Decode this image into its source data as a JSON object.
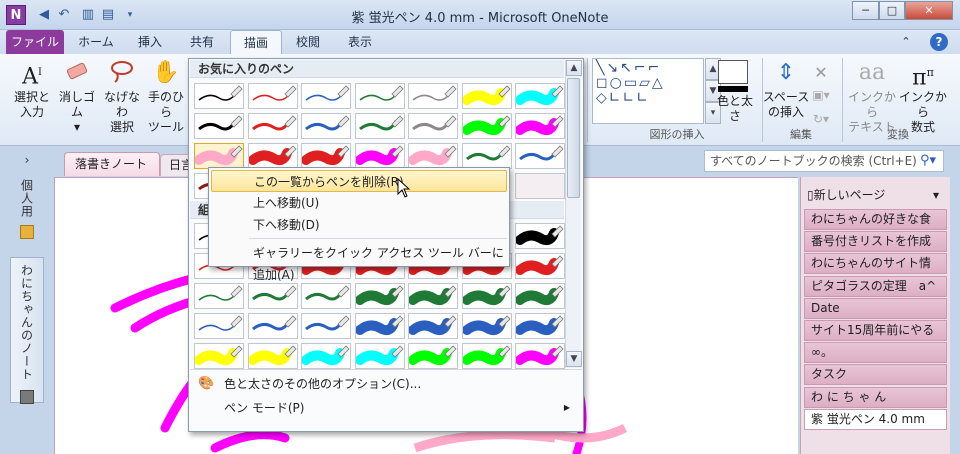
{
  "window": {
    "title": "紫 蛍光ペン 4.0 mm - Microsoft OneNote",
    "app_icon": "N",
    "buttons": {
      "minimize": "─",
      "maximize": "□",
      "close": "✕"
    }
  },
  "quick_access": [
    "back-icon",
    "undo-icon",
    "dock-icon",
    "page-icon",
    "customize-icon"
  ],
  "tabs": [
    {
      "label": "ファイル"
    },
    {
      "label": "ホーム"
    },
    {
      "label": "挿入"
    },
    {
      "label": "共有"
    },
    {
      "label": "描画"
    },
    {
      "label": "校閲"
    },
    {
      "label": "表示"
    }
  ],
  "ribbon": {
    "tools": [
      {
        "label": "選択と\n入力",
        "icon": "A"
      },
      {
        "label": "消しゴム\n▾",
        "icon": "eraser"
      },
      {
        "label": "なげなわ\n選択",
        "icon": "lasso"
      },
      {
        "label": "手のひら\nツール",
        "icon": "hand"
      }
    ],
    "color_thickness": "色と太さ",
    "insert_space": "スペース\nの挿入",
    "ink_to_text": "インクから\nテキスト",
    "ink_to_math": "インクから\n数式",
    "group_shapes": "図形の挿入",
    "group_edit": "編集",
    "group_convert": "変換"
  },
  "gallery": {
    "favorites_header": "お気に入りのペン",
    "builtin_header": "組み",
    "option_colors": "色と太さのその他のオプション(C)...",
    "option_pen_mode": "ペン モード(P)",
    "colors": {
      "black": "#000000",
      "red": "#e02020",
      "blue": "#2a5fbf",
      "green": "#1e7a34",
      "gray": "#8a8a8a",
      "yellow": "#ffff00",
      "cyan": "#00ffff",
      "lime": "#00ff00",
      "magenta": "#ff00ff",
      "pink": "#ffa8c8"
    }
  },
  "context_menu": {
    "items": [
      "この一覧からペンを削除(R)",
      "上へ移動(U)",
      "下へ移動(D)",
      "ギャラリーをクイック アクセス ツール バーに追加(A)"
    ]
  },
  "notebook": {
    "sidebar_notebooks": [
      "個人用",
      "わにちゃんのノート"
    ],
    "section_tab": "落書きノート",
    "section_tab2": "日言",
    "search_placeholder": "すべてのノートブックの検索 (Ctrl+E)",
    "new_page": "新しいページ",
    "pages": [
      "わにちゃんの好きな食",
      "番号付きリストを作成",
      "わにちゃんのサイト情",
      "ピタゴラスの定理　a^",
      "Date",
      "サイト15周年前にやる",
      "∞。",
      "タスク",
      "わ に ち ゃ ん",
      "紫 蛍光ペン 4.0 mm"
    ]
  }
}
